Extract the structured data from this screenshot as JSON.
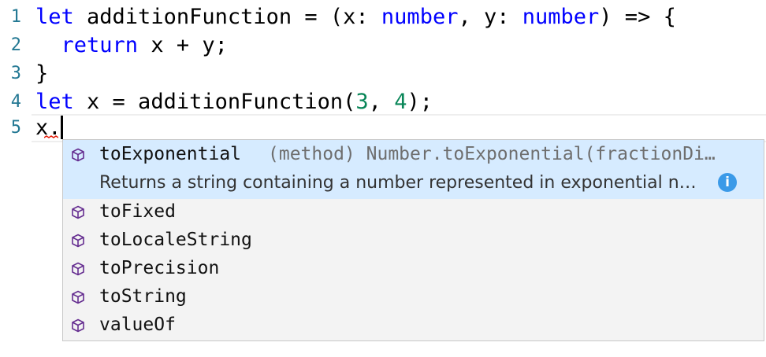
{
  "editor": {
    "lines": [
      {
        "number": "1",
        "tokens": [
          {
            "t": "let",
            "c": "kw"
          },
          {
            "t": " additionFunction = (x: ",
            "c": ""
          },
          {
            "t": "number",
            "c": "kw"
          },
          {
            "t": ", y: ",
            "c": ""
          },
          {
            "t": "number",
            "c": "kw"
          },
          {
            "t": ") => {",
            "c": ""
          }
        ]
      },
      {
        "number": "2",
        "tokens": [
          {
            "t": "  ",
            "c": ""
          },
          {
            "t": "return",
            "c": "kw"
          },
          {
            "t": " x + y;",
            "c": ""
          }
        ]
      },
      {
        "number": "3",
        "tokens": [
          {
            "t": "}",
            "c": ""
          }
        ]
      },
      {
        "number": "4",
        "tokens": [
          {
            "t": "let",
            "c": "kw"
          },
          {
            "t": " x = additionFunction(",
            "c": ""
          },
          {
            "t": "3",
            "c": "num"
          },
          {
            "t": ", ",
            "c": ""
          },
          {
            "t": "4",
            "c": "num"
          },
          {
            "t": ");",
            "c": ""
          }
        ]
      },
      {
        "number": "5",
        "tokens": [
          {
            "t": "x.",
            "c": ""
          }
        ]
      }
    ]
  },
  "suggest": {
    "selected": {
      "label": "toExponential",
      "detail": "(method) Number.toExponential(fractionDi…",
      "doc": "Returns a string containing a number represented in exponential n…",
      "info_glyph": "i"
    },
    "items": [
      {
        "label": "toFixed"
      },
      {
        "label": "toLocaleString"
      },
      {
        "label": "toPrecision"
      },
      {
        "label": "toString"
      },
      {
        "label": "valueOf"
      }
    ],
    "kind_icon": "method-cube-icon",
    "colors": {
      "selected_bg": "#d6ebff",
      "method_icon": "#652d90",
      "keyword": "#0000ff",
      "number": "#098658",
      "line_number": "#237893"
    }
  }
}
